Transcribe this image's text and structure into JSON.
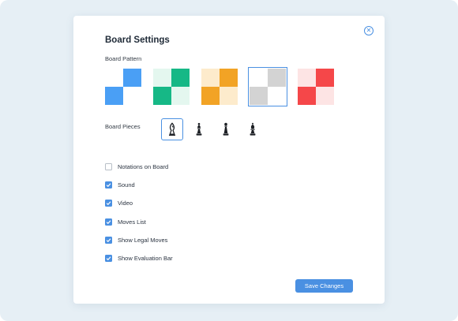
{
  "modal": {
    "title": "Board Settings",
    "close_icon": "close-circle-icon"
  },
  "board_pattern": {
    "label": "Board Pattern",
    "selected_index": 3,
    "patterns": [
      {
        "name": "white-blue",
        "light": "#ffffff",
        "dark": "#4a9ff5"
      },
      {
        "name": "mint-green",
        "light": "#e4f7ef",
        "dark": "#16b886"
      },
      {
        "name": "cream-orange",
        "light": "#fdebcc",
        "dark": "#f2a325"
      },
      {
        "name": "white-gray",
        "light": "#ffffff",
        "dark": "#d3d3d3"
      },
      {
        "name": "pink-red",
        "light": "#fde4e4",
        "dark": "#f54749"
      }
    ]
  },
  "board_pieces": {
    "label": "Board Pieces",
    "selected_index": 0,
    "pieces": [
      {
        "icon": "bishop-outline-icon"
      },
      {
        "icon": "bishop-icon"
      },
      {
        "icon": "pawn-icon"
      },
      {
        "icon": "bishop-solid-icon"
      }
    ]
  },
  "options": [
    {
      "label": "Notations on Board",
      "checked": false
    },
    {
      "label": "Sound",
      "checked": true
    },
    {
      "label": "Video",
      "checked": true
    },
    {
      "label": "Moves List",
      "checked": true
    },
    {
      "label": "Show Legal Moves",
      "checked": true
    },
    {
      "label": "Show Evaluation Bar",
      "checked": true
    }
  ],
  "save_button": {
    "label": "Save Changes"
  },
  "colors": {
    "accent": "#4a90e2",
    "backdrop": "#e6eff5"
  }
}
